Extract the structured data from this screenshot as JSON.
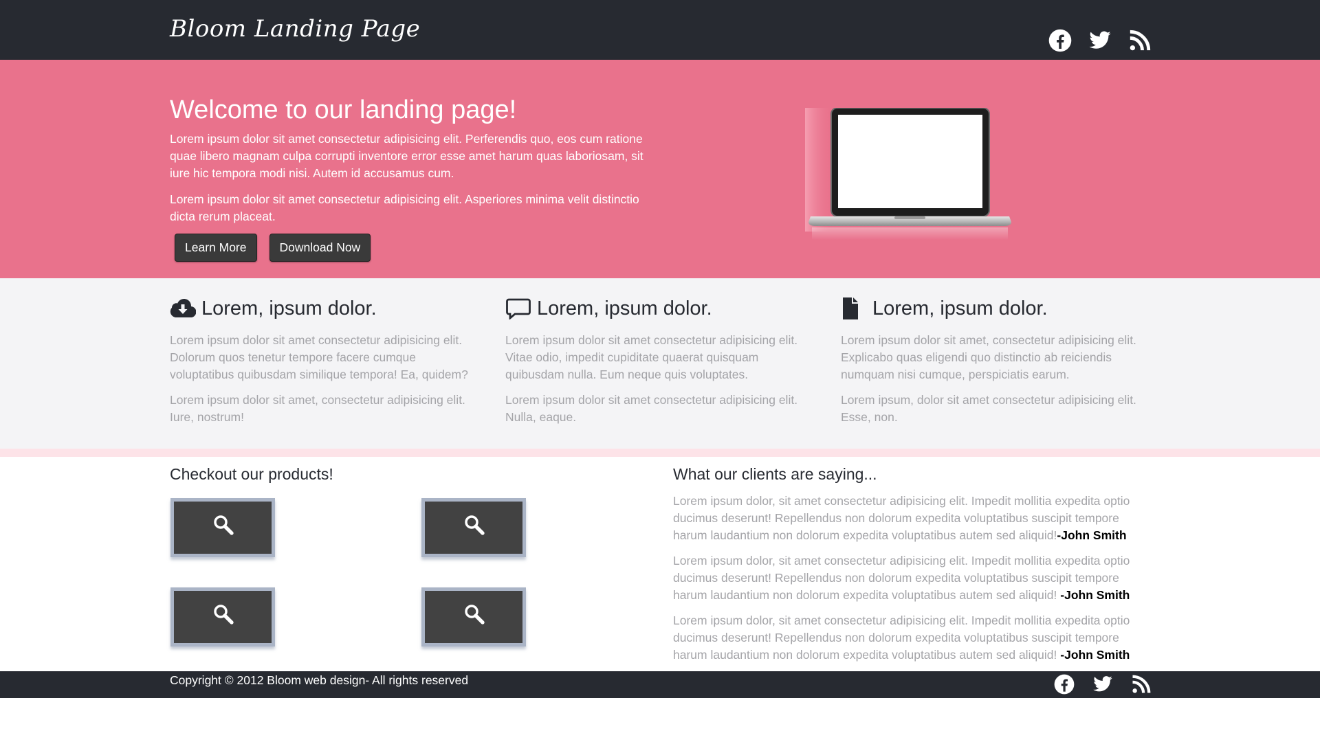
{
  "header": {
    "brand": "Bloom Landing Page",
    "social": [
      "facebook-icon",
      "twitter-icon",
      "rss-icon"
    ]
  },
  "hero": {
    "title": "Welcome to our landing page!",
    "paragraphs": [
      "Lorem ipsum dolor sit amet consectetur adipisicing elit. Perferendis quo, eos cum ratione quae libero magnam culpa corrupti inventore error esse amet harum quas laboriosam, sit iure hic tempora modi nisi. Autem id accusamus cum.",
      "Lorem ipsum dolor sit amet consectetur adipisicing elit. Asperiores minima velit distinctio dicta rerum placeat."
    ],
    "learn_more": "Learn More",
    "download_now": "Download Now"
  },
  "features": [
    {
      "icon": "cloud-download-icon",
      "title": "Lorem, ipsum dolor.",
      "paragraphs": [
        "Lorem ipsum dolor sit amet consectetur adipisicing elit. Dolorum quos tenetur tempore facere cumque voluptatibus quibusdam similique tempora! Ea, quidem?",
        "Lorem ipsum dolor sit amet, consectetur adipisicing elit. Iure, nostrum!"
      ]
    },
    {
      "icon": "comment-icon",
      "title": "Lorem, ipsum dolor.",
      "paragraphs": [
        "Lorem ipsum dolor sit amet consectetur adipisicing elit. Vitae odio, impedit cupiditate quaerat quisquam quibusdam nulla. Eum neque quis voluptates.",
        "Lorem ipsum dolor sit amet consectetur adipisicing elit. Nulla, eaque."
      ]
    },
    {
      "icon": "file-icon",
      "title": "Lorem, ipsum dolor.",
      "paragraphs": [
        "Lorem ipsum dolor sit amet, consectetur adipisicing elit. Explicabo quas eligendi quo distinctio ab reiciendis numquam nisi cumque, perspiciatis earum.",
        "Lorem ipsum, dolor sit amet consectetur adipisicing elit. Esse, non."
      ]
    }
  ],
  "products": {
    "title": "Checkout our products!",
    "icon": "magnifier-icon"
  },
  "testimonials": {
    "title": "What our clients are saying...",
    "items": [
      {
        "text": "Lorem ipsum dolor, sit amet consectetur adipisicing elit. Impedit mollitia expedita optio ducimus deserunt! Repellendus non dolorum expedita voluptatibus suscipit tempore harum laudantium non dolorum expedita voluptatibus autem sed aliquid!",
        "author": "-John Smith"
      },
      {
        "text": "Lorem ipsum dolor, sit amet consectetur adipisicing elit. Impedit mollitia expedita optio ducimus deserunt! Repellendus non dolorum expedita voluptatibus suscipit tempore harum laudantium non dolorum expedita voluptatibus autem sed aliquid! ",
        "author": "-John Smith"
      },
      {
        "text": "Lorem ipsum dolor, sit amet consectetur adipisicing elit. Impedit mollitia expedita optio ducimus deserunt! Repellendus non dolorum expedita voluptatibus suscipit tempore harum laudantium non dolorum expedita voluptatibus autem sed aliquid! ",
        "author": "-John Smith"
      }
    ]
  },
  "footer": {
    "copyright": "Copyright © 2012 Bloom web design- All rights reserved",
    "social": [
      "facebook-icon",
      "twitter-icon",
      "rss-icon"
    ]
  },
  "colors": {
    "dark": "#272a31",
    "hero_pink": "#e9728c",
    "feature_bg": "#f4f4f6",
    "muted_text": "#a4a4a8"
  }
}
